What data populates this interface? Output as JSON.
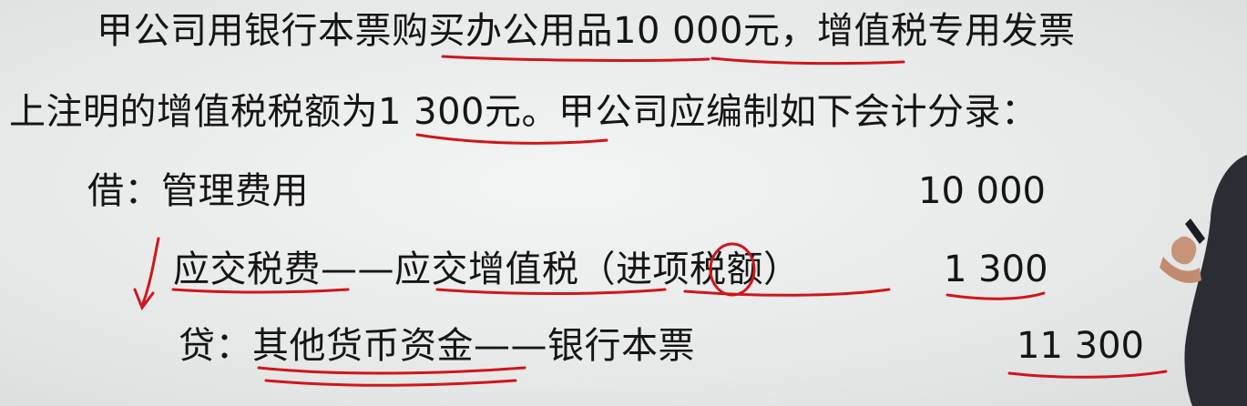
{
  "paragraph": {
    "line1": "甲公司用银行本票购买办公用品10 000元，增值税专用发票",
    "line2": "上注明的增值税税额为1 300元。甲公司应编制如下会计分录："
  },
  "entries": [
    {
      "label": "借：管理费用",
      "amount": "10 000"
    },
    {
      "label": "应交税费——应交增值税（进项税额）",
      "amount": "1 300"
    },
    {
      "label": "贷：其他货币资金——银行本票",
      "amount": "11 300"
    }
  ],
  "colors": {
    "text": "#151515",
    "annotation": "#d0151c",
    "background": "#e8ebea"
  },
  "icons": [
    "down-arrow-annotation-icon",
    "circle-annotation-icon"
  ]
}
